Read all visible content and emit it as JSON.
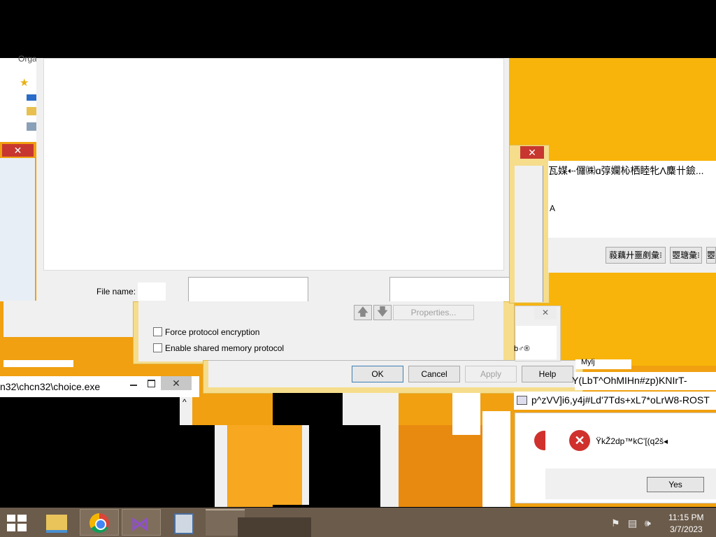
{
  "explorer": {
    "organize_label": "Orga",
    "file_name_label": "File name:"
  },
  "network_dialog": {
    "checkboxes": [
      {
        "label": "Force protocol encryption",
        "checked": false
      },
      {
        "label": "Enable shared memory protocol",
        "checked": false
      }
    ],
    "properties_button": "Properties...",
    "buttons": {
      "ok": "OK",
      "cancel": "Cancel",
      "apply": "Apply",
      "help": "Help"
    }
  },
  "cjk_dialog": {
    "text": "瓦媒⇠儸㈱ɑ弴孄杺栖睦牝Λ麋卄鐱...",
    "line2": "A",
    "buttons": [
      "蔱藕廾噩剷彙⁝",
      "瞾瑭彙⁝",
      "瞾"
    ]
  },
  "console": {
    "title": "n32\\chcn32\\choice.exe",
    "scroll_up": "^"
  },
  "garbled_windows": {
    "line1": "Y(LbT^OhMIHn#zp)KNIrT-",
    "line2": "p^zVV]i6,y4j#Ld'7Tds+xL7*oLrW8-ROST",
    "small_text1": "b♂®",
    "small_text2": "Mylj"
  },
  "error_dialog": {
    "message": "ŸkŽ2dp™kC'[(q2š◂",
    "yes_button": "Yes"
  },
  "taskbar": {
    "items": [
      "file-explorer",
      "chrome",
      "visual-studio",
      "notepad"
    ],
    "time": "11:15 PM",
    "date": "3/7/2023"
  },
  "colors": {
    "desktop_orange": "#f0a010",
    "desktop_yellow": "#f8b40a",
    "close_red": "#c7372f",
    "dialog_border": "#f6dd8c",
    "taskbar": "#6b5b4b"
  }
}
